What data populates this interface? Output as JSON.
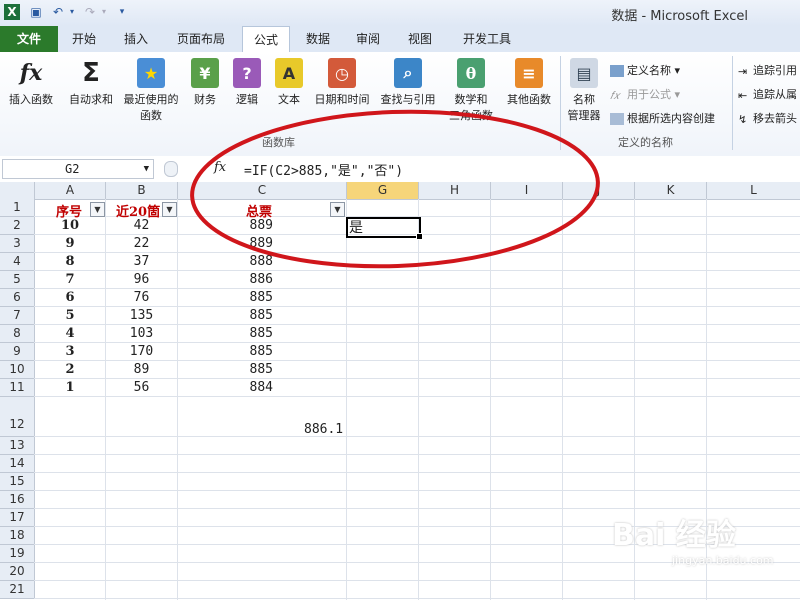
{
  "window": {
    "title": "数据 - Microsoft Excel"
  },
  "quick_access": [
    "excel-logo-icon",
    "save-icon",
    "undo-icon",
    "redo-icon",
    "customize-icon"
  ],
  "tabs": [
    {
      "label": "文件"
    },
    {
      "label": "开始"
    },
    {
      "label": "插入"
    },
    {
      "label": "页面布局"
    },
    {
      "label": "公式"
    },
    {
      "label": "数据"
    },
    {
      "label": "审阅"
    },
    {
      "label": "视图"
    },
    {
      "label": "开发工具"
    }
  ],
  "ribbon": {
    "function_library": {
      "group_label": "函数库",
      "buttons": [
        {
          "label": "插入函数",
          "icon": "fx"
        },
        {
          "label": "自动求和",
          "icon": "Σ"
        },
        {
          "label": "最近使用的\n函数",
          "icon": "★"
        },
        {
          "label": "财务",
          "icon": "¥"
        },
        {
          "label": "逻辑",
          "icon": "?"
        },
        {
          "label": "文本",
          "icon": "A"
        },
        {
          "label": "日期和时间",
          "icon": "◷"
        },
        {
          "label": "查找与引用",
          "icon": "⌕"
        },
        {
          "label": "数学和\n三角函数",
          "icon": "θ"
        },
        {
          "label": "其他函数",
          "icon": "≡"
        }
      ]
    },
    "defined_names": {
      "group_label": "定义的名称",
      "manager_label": "名称\n管理器",
      "define_name": "定义名称",
      "use_in_formula": "用于公式",
      "create_from_selection": "根据所选内容创建"
    },
    "formula_auditing": {
      "trace_precedents": "追踪引用",
      "trace_dependents": "追踪从属",
      "remove_arrows": "移去箭头"
    }
  },
  "formula_bar": {
    "name_box": "G2",
    "fx_label": "fx",
    "formula": "=IF(C2>885,\"是\",\"否\")"
  },
  "sheet": {
    "columns": [
      "A",
      "B",
      "C",
      "G",
      "H",
      "I",
      "J",
      "K",
      "L"
    ],
    "selected_column": "G",
    "rows": [
      "1",
      "2",
      "3",
      "4",
      "5",
      "6",
      "7",
      "8",
      "9",
      "10",
      "11",
      "12",
      "13",
      "14",
      "15",
      "16",
      "17",
      "18",
      "19",
      "20",
      "21"
    ],
    "header_row": {
      "A": "序号",
      "B": "近20箇",
      "C": "总票"
    },
    "data": [
      {
        "A": "10",
        "B": "42",
        "C": "889",
        "G": "是"
      },
      {
        "A": "9",
        "B": "22",
        "C": "889",
        "G": ""
      },
      {
        "A": "8",
        "B": "37",
        "C": "888",
        "G": ""
      },
      {
        "A": "7",
        "B": "96",
        "C": "886",
        "G": ""
      },
      {
        "A": "6",
        "B": "76",
        "C": "885",
        "G": ""
      },
      {
        "A": "5",
        "B": "135",
        "C": "885",
        "G": ""
      },
      {
        "A": "4",
        "B": "103",
        "C": "885",
        "G": ""
      },
      {
        "A": "3",
        "B": "170",
        "C": "885",
        "G": ""
      },
      {
        "A": "2",
        "B": "89",
        "C": "885",
        "G": ""
      },
      {
        "A": "1",
        "B": "56",
        "C": "884",
        "G": ""
      }
    ],
    "row12_value": "886.1"
  },
  "watermark": {
    "line1": "Bai 经验",
    "line2": "jingyan.baidu.com"
  },
  "colors": {
    "file_tab": "#2b7a2b",
    "header_text": "#c00000",
    "annotation_circle": "#d0161b"
  }
}
